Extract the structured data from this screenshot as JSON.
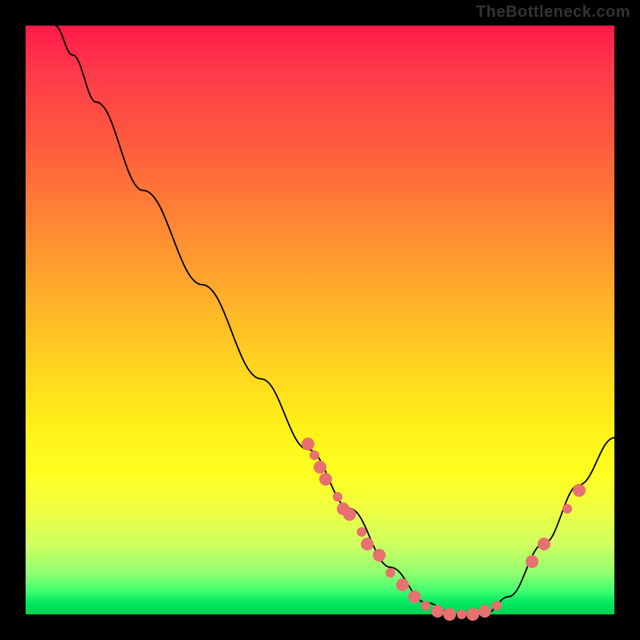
{
  "watermark": "TheBottleneck.com",
  "chart_data": {
    "type": "line",
    "title": "",
    "xlabel": "",
    "ylabel": "",
    "xlim": [
      0,
      100
    ],
    "ylim": [
      0,
      100
    ],
    "curve": [
      {
        "x": 5,
        "y": 100
      },
      {
        "x": 8,
        "y": 95
      },
      {
        "x": 12,
        "y": 87
      },
      {
        "x": 20,
        "y": 72
      },
      {
        "x": 30,
        "y": 56
      },
      {
        "x": 40,
        "y": 40
      },
      {
        "x": 48,
        "y": 28
      },
      {
        "x": 55,
        "y": 18
      },
      {
        "x": 62,
        "y": 8
      },
      {
        "x": 68,
        "y": 2
      },
      {
        "x": 73,
        "y": 0
      },
      {
        "x": 78,
        "y": 0
      },
      {
        "x": 82,
        "y": 3
      },
      {
        "x": 88,
        "y": 12
      },
      {
        "x": 94,
        "y": 22
      },
      {
        "x": 100,
        "y": 30
      }
    ],
    "dots": [
      {
        "x": 48,
        "y": 29
      },
      {
        "x": 49,
        "y": 27
      },
      {
        "x": 50,
        "y": 25
      },
      {
        "x": 51,
        "y": 23
      },
      {
        "x": 53,
        "y": 20
      },
      {
        "x": 54,
        "y": 18
      },
      {
        "x": 55,
        "y": 17
      },
      {
        "x": 57,
        "y": 14
      },
      {
        "x": 58,
        "y": 12
      },
      {
        "x": 60,
        "y": 10
      },
      {
        "x": 62,
        "y": 7
      },
      {
        "x": 64,
        "y": 5
      },
      {
        "x": 66,
        "y": 3
      },
      {
        "x": 68,
        "y": 1.5
      },
      {
        "x": 70,
        "y": 0.5
      },
      {
        "x": 72,
        "y": 0
      },
      {
        "x": 74,
        "y": 0
      },
      {
        "x": 76,
        "y": 0
      },
      {
        "x": 78,
        "y": 0.5
      },
      {
        "x": 80,
        "y": 1.5
      },
      {
        "x": 86,
        "y": 9
      },
      {
        "x": 88,
        "y": 12
      },
      {
        "x": 92,
        "y": 18
      },
      {
        "x": 94,
        "y": 21
      }
    ],
    "background_gradient": {
      "top": "#ff1a4a",
      "middle": "#ffd520",
      "bottom": "#00d050"
    }
  }
}
